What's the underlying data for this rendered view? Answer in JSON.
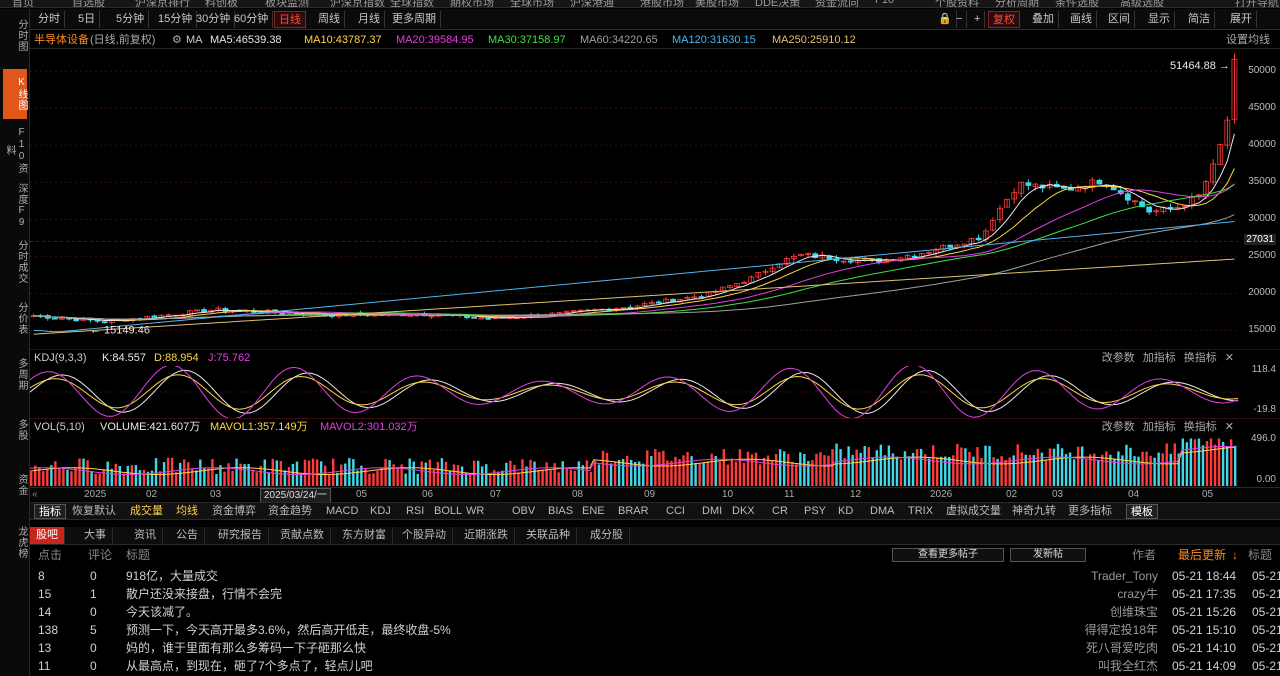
{
  "top_menu": [
    "首页",
    "自选股",
    "沪深京排行",
    "科创板",
    "板块监测",
    "沪深京指数",
    "全球指数",
    "期权市场",
    "全球市场",
    "沪深港通",
    "港股市场",
    "美股市场",
    "DDE决策",
    "资金流向",
    "F10",
    "个股资料",
    "分析周期",
    "条件选股",
    "高级选股",
    "打开导航"
  ],
  "toolbar": {
    "buttons": [
      "分时",
      "5日",
      "5分钟",
      "15分钟",
      "30分钟",
      "60分钟",
      "日线",
      "周线",
      "月线",
      "更多周期"
    ],
    "right_buttons": [
      "复权",
      "叠加",
      "画线",
      "区间",
      "显示",
      "简洁",
      "展开"
    ],
    "active_period": "日线",
    "lock_icon": "lock-icon",
    "minus_icon": "minus-icon",
    "plus_icon": "plus-icon"
  },
  "left_nav": [
    "分时图",
    "K线图",
    "F10资料",
    "深度F9",
    "分时成交",
    "分价表",
    "多周期",
    "多股",
    "资金",
    "龙虎榜"
  ],
  "left_nav_active": "K线图",
  "chart": {
    "stock_name": "半导体设备",
    "adjust": "(日线,前复权)",
    "ma_label": "MA",
    "ma": [
      {
        "label": "MA5:46539.38",
        "color": "#e8e8e8"
      },
      {
        "label": "MA10:43787.37",
        "color": "#ffd447"
      },
      {
        "label": "MA20:39584.95",
        "color": "#e040e0"
      },
      {
        "label": "MA30:37158.97",
        "color": "#40e040"
      },
      {
        "label": "MA60:34220.65",
        "color": "#a0a0a0"
      },
      {
        "label": "MA120:31630.15",
        "color": "#4fb3f0"
      },
      {
        "label": "MA250:25910.12",
        "color": "#e0c070"
      }
    ],
    "settings": "设置均线",
    "high_label": "51464.88",
    "low_label": "15149.46",
    "current_price": "27031",
    "price_axis": [
      "50000",
      "45000",
      "40000",
      "35000",
      "30000",
      "25000",
      "20000",
      "15000"
    ],
    "y_min": 12500,
    "y_max": 53000
  },
  "kdj": {
    "name": "KDJ(9,3,3)",
    "k": "K:84.557",
    "d": "D:88.954",
    "j": "J:75.762",
    "axis_top": "118.4",
    "axis_bottom": "-19.8",
    "btn_params": "改参数",
    "btn_add": "加指标",
    "btn_switch": "换指标"
  },
  "vol": {
    "name": "VOL(5,10)",
    "volume": "VOLUME:421.607万",
    "mavol1": "MAVOL1:357.149万",
    "mavol2": "MAVOL2:301.032万",
    "axis_top": "496.0",
    "axis_bottom": "0.00",
    "btn_params": "改参数",
    "btn_add": "加指标",
    "btn_switch": "换指标"
  },
  "dates": [
    "2025",
    "02",
    "03",
    "2025/03/24/一",
    "05",
    "06",
    "07",
    "08",
    "09",
    "10",
    "11",
    "12",
    "2026",
    "02",
    "03",
    "04",
    "05"
  ],
  "indicator_tabs": [
    "指标",
    "恢复默认",
    "成交量",
    "均线",
    "资金博弈",
    "资金趋势",
    "MACD",
    "KDJ",
    "RSI",
    "BOLL",
    "WR",
    "OBV",
    "BIAS",
    "ENE",
    "BRAR",
    "CCI",
    "DMI",
    "DKX",
    "CR",
    "PSY",
    "KD",
    "DMA",
    "TRIX",
    "虚拟成交量",
    "神奇九转",
    "更多指标",
    "模板"
  ],
  "news_tabs": [
    "股吧",
    "大事",
    "资讯",
    "公告",
    "研究报告",
    "贡献点数",
    "东方财富",
    "个股异动",
    "近期涨跌",
    "关联品种",
    "成分股"
  ],
  "news_header": {
    "clicks": "点击",
    "comments": "评论",
    "title": "标题",
    "view_more": "查看更多帖子",
    "post": "发新帖",
    "author": "作者",
    "last_update": "最后更新",
    "sort_arrow": "↓"
  },
  "posts": [
    {
      "clicks": "8",
      "comments": "0",
      "title": "918亿，大量成交",
      "author": "Trader_Tony",
      "time": "05-21 18:44"
    },
    {
      "clicks": "15",
      "comments": "1",
      "title": "散户还没来接盘，行情不会完",
      "author": "crazy牛",
      "time": "05-21 17:35"
    },
    {
      "clicks": "14",
      "comments": "0",
      "title": "今天该减了。",
      "author": "创维珠宝",
      "time": "05-21 15:26"
    },
    {
      "clicks": "138",
      "comments": "5",
      "title": "预测一下，今天高开最多3.6%，然后高开低走，最终收盘-5%",
      "author": "得得定投18年",
      "time": "05-21 15:10"
    },
    {
      "clicks": "13",
      "comments": "0",
      "title": "妈的，谁于里面有那么多筹码一下子砸那么快",
      "author": "死八哥爱吃肉",
      "time": "05-21 14:10"
    },
    {
      "clicks": "11",
      "comments": "0",
      "title": "从最高点，到现在，砸了7个多点了，轻点儿吧",
      "author": "叫我全红杰",
      "time": "05-21 14:09"
    }
  ]
}
